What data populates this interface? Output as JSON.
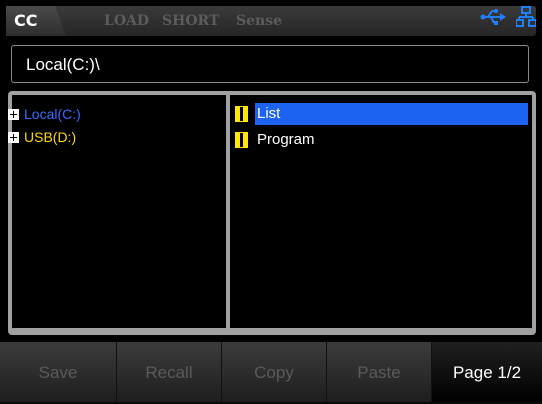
{
  "status_bar": {
    "mode": "CC",
    "indicators": [
      "LOAD",
      "SHORT",
      "Sense"
    ],
    "icons": [
      "usb-icon",
      "lan-icon"
    ],
    "icon_color": "#1e7fff"
  },
  "path_bar": {
    "path": "Local(C:)\\"
  },
  "directory_tree": {
    "items": [
      {
        "label": "Local(C:)",
        "color": "#3b6bff",
        "icon": "plus-expand-icon"
      },
      {
        "label": "USB(D:)",
        "color": "#ffd800",
        "icon": "plus-expand-icon"
      }
    ]
  },
  "file_list": {
    "items": [
      {
        "label": "List",
        "selected": true,
        "icon": "folder-icon"
      },
      {
        "label": "Program",
        "selected": false,
        "icon": "folder-icon"
      }
    ],
    "selection_color": "#1c63f1"
  },
  "softkeys": {
    "save": "Save",
    "recall": "Recall",
    "copy": "Copy",
    "paste": "Paste",
    "page": "Page 1/2"
  }
}
